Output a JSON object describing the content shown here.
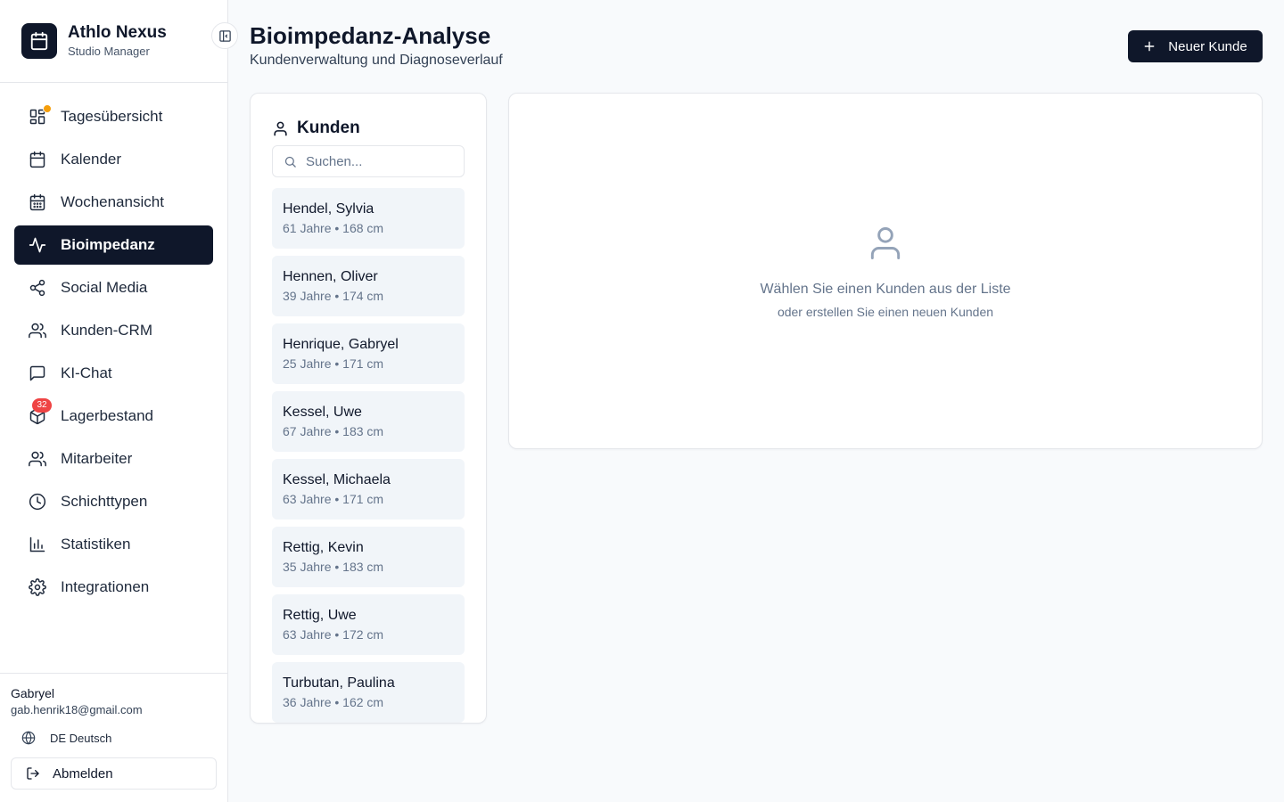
{
  "app": {
    "name": "Athlo Nexus",
    "subtitle": "Studio Manager"
  },
  "sidebar": {
    "items": [
      {
        "label": "Tagesübersicht",
        "icon": "dashboard-icon",
        "badge_dot": true
      },
      {
        "label": "Kalender",
        "icon": "calendar-icon"
      },
      {
        "label": "Wochenansicht",
        "icon": "calendar-grid-icon"
      },
      {
        "label": "Bioimpedanz",
        "icon": "activity-icon",
        "active": true
      },
      {
        "label": "Social Media",
        "icon": "share-icon"
      },
      {
        "label": "Kunden-CRM",
        "icon": "users-icon"
      },
      {
        "label": "KI-Chat",
        "icon": "message-icon"
      },
      {
        "label": "Lagerbestand",
        "icon": "package-icon",
        "badge_count": "32"
      },
      {
        "label": "Mitarbeiter",
        "icon": "users-icon"
      },
      {
        "label": "Schichttypen",
        "icon": "clock-icon"
      },
      {
        "label": "Statistiken",
        "icon": "bar-chart-icon"
      },
      {
        "label": "Integrationen",
        "icon": "gear-icon"
      }
    ]
  },
  "user": {
    "name": "Gabryel",
    "email": "gab.henrik18@gmail.com"
  },
  "language": {
    "label": "DE Deutsch"
  },
  "logout": {
    "label": "Abmelden"
  },
  "page": {
    "title": "Bioimpedanz-Analyse",
    "subtitle": "Kundenverwaltung und Diagnoseverlauf",
    "new_button": "Neuer Kunde"
  },
  "customers": {
    "title": "Kunden",
    "search_placeholder": "Suchen...",
    "list": [
      {
        "name": "Hendel, Sylvia",
        "meta": "61 Jahre • 168 cm"
      },
      {
        "name": "Hennen, Oliver",
        "meta": "39 Jahre • 174 cm"
      },
      {
        "name": "Henrique, Gabryel",
        "meta": "25 Jahre • 171 cm"
      },
      {
        "name": "Kessel, Uwe",
        "meta": "67 Jahre • 183 cm"
      },
      {
        "name": "Kessel, Michaela",
        "meta": "63 Jahre • 171 cm"
      },
      {
        "name": "Rettig, Kevin",
        "meta": "35 Jahre • 183 cm"
      },
      {
        "name": "Rettig, Uwe",
        "meta": "63 Jahre • 172 cm"
      },
      {
        "name": "Turbutan, Paulina",
        "meta": "36 Jahre • 162 cm"
      }
    ]
  },
  "empty_state": {
    "title": "Wählen Sie einen Kunden aus der Liste",
    "subtitle": "oder erstellen Sie einen neuen Kunden"
  },
  "colors": {
    "primary": "#0f172a",
    "badge": "#ef4444",
    "dot": "#f59e0b"
  }
}
